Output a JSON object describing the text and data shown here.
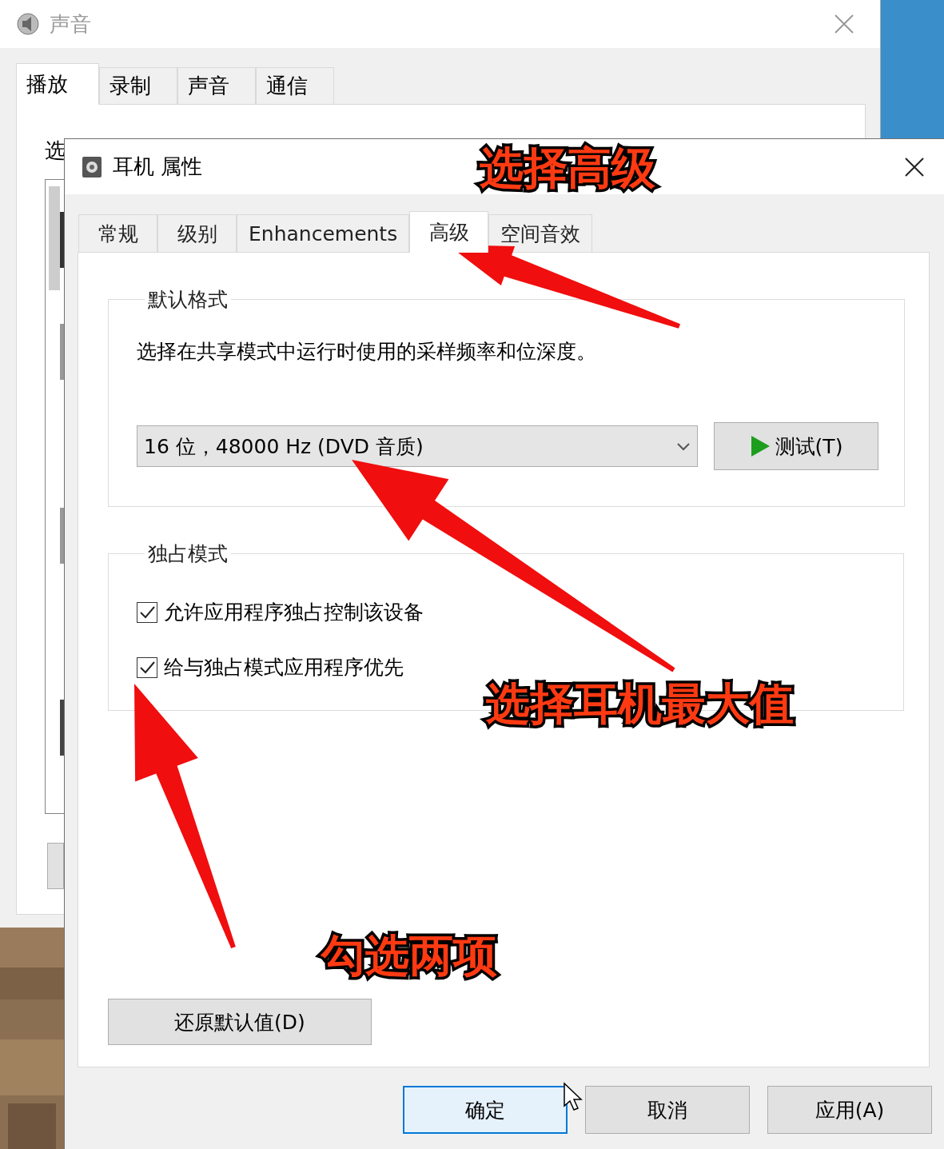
{
  "background_window": {
    "title": "声音",
    "tabs": [
      {
        "label": "播放",
        "selected": true
      },
      {
        "label": "录制",
        "selected": false
      },
      {
        "label": "声音",
        "selected": false
      },
      {
        "label": "通信",
        "selected": false
      }
    ],
    "partial_text": "选"
  },
  "dialog": {
    "title": "耳机 属性",
    "tabs": [
      {
        "label": "常规",
        "selected": false
      },
      {
        "label": "级别",
        "selected": false
      },
      {
        "label": "Enhancements",
        "selected": false
      },
      {
        "label": "高级",
        "selected": true
      },
      {
        "label": "空间音效",
        "selected": false
      }
    ],
    "default_format": {
      "title": "默认格式",
      "description": "选择在共享模式中运行时使用的采样频率和位深度。",
      "format_select": {
        "value": "16 位，48000 Hz (DVD 音质)"
      },
      "test_button": "测试(T)"
    },
    "exclusive_mode": {
      "title": "独占模式",
      "options": [
        {
          "label": "允许应用程序独占控制该设备",
          "checked": true
        },
        {
          "label": "给与独占模式应用程序优先",
          "checked": true
        }
      ]
    },
    "restore_button": "还原默认值(D)",
    "buttons": [
      {
        "label": "确定",
        "focused": true
      },
      {
        "label": "取消",
        "focused": false
      },
      {
        "label": "应用(A)",
        "focused": false
      }
    ]
  },
  "annotations": [
    {
      "text": "选择高级"
    },
    {
      "text": "选择耳机最大值"
    },
    {
      "text": "勾选两项"
    }
  ]
}
